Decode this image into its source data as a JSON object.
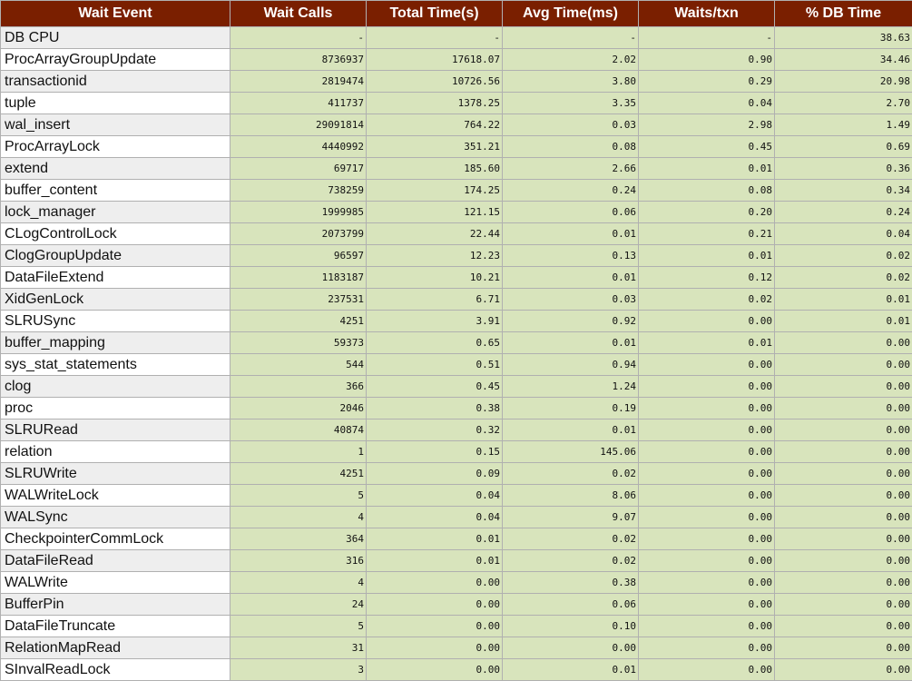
{
  "columns": [
    "Wait Event",
    "Wait Calls",
    "Total Time(s)",
    "Avg Time(ms)",
    "Waits/txn",
    "% DB Time"
  ],
  "rows": [
    [
      "DB CPU",
      "-",
      "-",
      "-",
      "-",
      "38.63"
    ],
    [
      "ProcArrayGroupUpdate",
      "8736937",
      "17618.07",
      "2.02",
      "0.90",
      "34.46"
    ],
    [
      "transactionid",
      "2819474",
      "10726.56",
      "3.80",
      "0.29",
      "20.98"
    ],
    [
      "tuple",
      "411737",
      "1378.25",
      "3.35",
      "0.04",
      "2.70"
    ],
    [
      "wal_insert",
      "29091814",
      "764.22",
      "0.03",
      "2.98",
      "1.49"
    ],
    [
      "ProcArrayLock",
      "4440992",
      "351.21",
      "0.08",
      "0.45",
      "0.69"
    ],
    [
      "extend",
      "69717",
      "185.60",
      "2.66",
      "0.01",
      "0.36"
    ],
    [
      "buffer_content",
      "738259",
      "174.25",
      "0.24",
      "0.08",
      "0.34"
    ],
    [
      "lock_manager",
      "1999985",
      "121.15",
      "0.06",
      "0.20",
      "0.24"
    ],
    [
      "CLogControlLock",
      "2073799",
      "22.44",
      "0.01",
      "0.21",
      "0.04"
    ],
    [
      "ClogGroupUpdate",
      "96597",
      "12.23",
      "0.13",
      "0.01",
      "0.02"
    ],
    [
      "DataFileExtend",
      "1183187",
      "10.21",
      "0.01",
      "0.12",
      "0.02"
    ],
    [
      "XidGenLock",
      "237531",
      "6.71",
      "0.03",
      "0.02",
      "0.01"
    ],
    [
      "SLRUSync",
      "4251",
      "3.91",
      "0.92",
      "0.00",
      "0.01"
    ],
    [
      "buffer_mapping",
      "59373",
      "0.65",
      "0.01",
      "0.01",
      "0.00"
    ],
    [
      "sys_stat_statements",
      "544",
      "0.51",
      "0.94",
      "0.00",
      "0.00"
    ],
    [
      "clog",
      "366",
      "0.45",
      "1.24",
      "0.00",
      "0.00"
    ],
    [
      "proc",
      "2046",
      "0.38",
      "0.19",
      "0.00",
      "0.00"
    ],
    [
      "SLRURead",
      "40874",
      "0.32",
      "0.01",
      "0.00",
      "0.00"
    ],
    [
      "relation",
      "1",
      "0.15",
      "145.06",
      "0.00",
      "0.00"
    ],
    [
      "SLRUWrite",
      "4251",
      "0.09",
      "0.02",
      "0.00",
      "0.00"
    ],
    [
      "WALWriteLock",
      "5",
      "0.04",
      "8.06",
      "0.00",
      "0.00"
    ],
    [
      "WALSync",
      "4",
      "0.04",
      "9.07",
      "0.00",
      "0.00"
    ],
    [
      "CheckpointerCommLock",
      "364",
      "0.01",
      "0.02",
      "0.00",
      "0.00"
    ],
    [
      "DataFileRead",
      "316",
      "0.01",
      "0.02",
      "0.00",
      "0.00"
    ],
    [
      "WALWrite",
      "4",
      "0.00",
      "0.38",
      "0.00",
      "0.00"
    ],
    [
      "BufferPin",
      "24",
      "0.00",
      "0.06",
      "0.00",
      "0.00"
    ],
    [
      "DataFileTruncate",
      "5",
      "0.00",
      "0.10",
      "0.00",
      "0.00"
    ],
    [
      "RelationMapRead",
      "31",
      "0.00",
      "0.00",
      "0.00",
      "0.00"
    ],
    [
      "SInvalReadLock",
      "3",
      "0.00",
      "0.01",
      "0.00",
      "0.00"
    ]
  ]
}
